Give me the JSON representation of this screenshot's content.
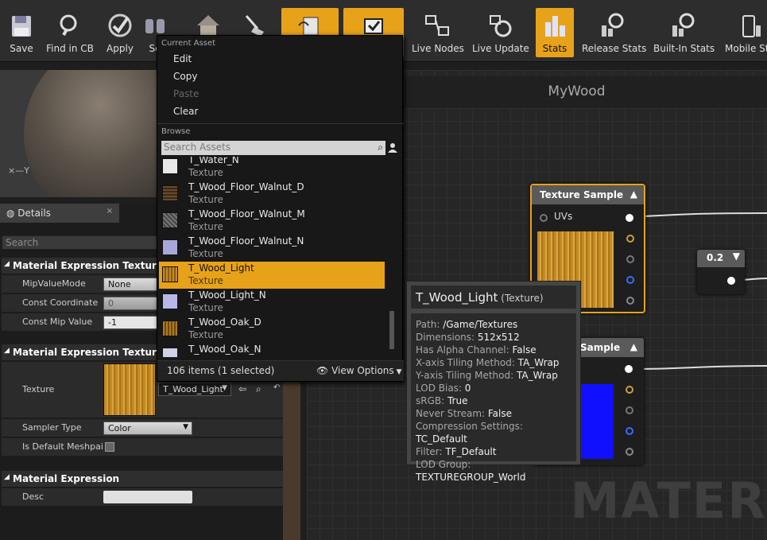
{
  "toolbar": {
    "buttons": [
      {
        "id": "save",
        "label": "Save",
        "icon": "floppy-disk-icon",
        "active": false
      },
      {
        "id": "find",
        "label": "Find in CB",
        "icon": "magnifier-icon",
        "active": false
      },
      {
        "id": "apply",
        "label": "Apply",
        "icon": "checkmark-circle-icon",
        "active": false
      },
      {
        "id": "search",
        "label": "Se",
        "icon": "binoculars-icon",
        "active": false
      },
      {
        "id": "home",
        "label": "",
        "icon": "house-icon",
        "active": false
      },
      {
        "id": "clean",
        "label": "",
        "icon": "broom-icon",
        "active": false
      },
      {
        "id": "preview",
        "label": "",
        "icon": "node-preview-icon",
        "active": true
      },
      {
        "id": "tv",
        "label": "",
        "icon": "realtime-preview-icon",
        "active": true
      },
      {
        "id": "live-nodes",
        "label": "Live Nodes",
        "icon": "live-nodes-icon",
        "active": false
      },
      {
        "id": "live-update",
        "label": "Live Update",
        "icon": "live-update-icon",
        "active": false
      },
      {
        "id": "stats",
        "label": "Stats",
        "icon": "stats-icon",
        "active": true
      },
      {
        "id": "release-stats",
        "label": "Release Stats",
        "icon": "release-stats-icon",
        "active": false
      },
      {
        "id": "builtin-stats",
        "label": "Built-In Stats",
        "icon": "builtin-stats-icon",
        "active": false
      },
      {
        "id": "mobile-stats",
        "label": "Mobile Sta",
        "icon": "mobile-stats-icon",
        "active": false
      }
    ]
  },
  "viewport": {
    "axis_label": "Y"
  },
  "details": {
    "tab_label": "Details",
    "close_glyph": "×",
    "search_placeholder": "Search",
    "sections": {
      "texture_sample": "Material Expression Texture Sa",
      "texture_base": "Material Expression Texture Bas",
      "expression": "Material Expression"
    },
    "mip_value_mode": {
      "label": "MipValueMode",
      "value": "None"
    },
    "const_coordinate": {
      "label": "Const Coordinate",
      "value": "0"
    },
    "const_mip_value": {
      "label": "Const Mip Value",
      "value": "-1"
    },
    "texture": {
      "label": "Texture",
      "value": "T_Wood_Light"
    },
    "sampler_type": {
      "label": "Sampler Type",
      "value": "Color"
    },
    "is_default_meshpaint": {
      "label": "Is Default Meshpai"
    },
    "desc": {
      "label": "Desc",
      "value": ""
    }
  },
  "graph": {
    "title": "MyWood",
    "watermark": "MATER",
    "node1": {
      "title": "Texture Sample",
      "uv_label": "UVs"
    },
    "node2": {
      "title": "Sample"
    },
    "const_node": {
      "value": "0.2"
    }
  },
  "menu": {
    "current_asset_label": "Current Asset",
    "edit": "Edit",
    "copy": "Copy",
    "paste": "Paste",
    "clear": "Clear",
    "browse_label": "Browse",
    "search_placeholder": "Search Assets",
    "items": [
      {
        "name": "T_Water_N",
        "type": "Texture",
        "selected": false
      },
      {
        "name": "T_Wood_Floor_Walnut_D",
        "type": "Texture",
        "selected": false
      },
      {
        "name": "T_Wood_Floor_Walnut_M",
        "type": "Texture",
        "selected": false
      },
      {
        "name": "T_Wood_Floor_Walnut_N",
        "type": "Texture",
        "selected": false
      },
      {
        "name": "T_Wood_Light",
        "type": "Texture",
        "selected": true
      },
      {
        "name": "T_Wood_Light_N",
        "type": "Texture",
        "selected": false
      },
      {
        "name": "T_Wood_Oak_D",
        "type": "Texture",
        "selected": false
      },
      {
        "name": "T_Wood_Oak_N",
        "type": "Texture",
        "selected": false
      }
    ],
    "count_text": "106 items (1 selected)",
    "view_options": "View Options"
  },
  "tooltip": {
    "name": "T_Wood_Light",
    "type": "(Texture)",
    "rows": [
      {
        "k": "Path:",
        "v": "/Game/Textures"
      },
      {
        "k": "Dimensions:",
        "v": "512x512"
      },
      {
        "k": "Has Alpha Channel:",
        "v": "False"
      },
      {
        "k": "X-axis Tiling Method:",
        "v": "TA_Wrap"
      },
      {
        "k": "Y-axis Tiling Method:",
        "v": "TA_Wrap"
      },
      {
        "k": "LOD Bias:",
        "v": "0"
      },
      {
        "k": "sRGB:",
        "v": "True"
      },
      {
        "k": "Never Stream:",
        "v": "False"
      },
      {
        "k": "Compression Settings:",
        "v": "TC_Default"
      },
      {
        "k": "Filter:",
        "v": "TF_Default"
      },
      {
        "k": "LOD Group:",
        "v": "TEXTUREGROUP_World"
      }
    ]
  },
  "colors": {
    "accent": "#e8a219",
    "panel": "#2b2b2b",
    "wood": "#c9952a",
    "blue": "#1010ff"
  }
}
